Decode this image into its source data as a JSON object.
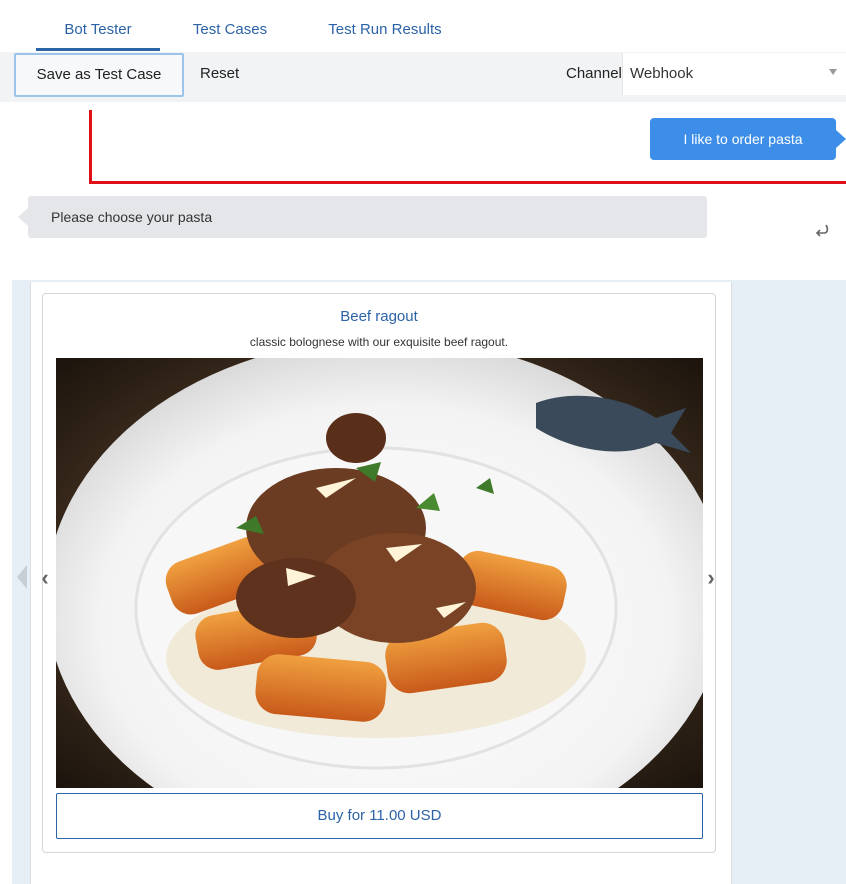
{
  "tabs": {
    "items": [
      {
        "label": "Bot Tester",
        "active": true
      },
      {
        "label": "Test Cases",
        "active": false
      },
      {
        "label": "Test Run Results",
        "active": false
      }
    ]
  },
  "toolbar": {
    "save_label": "Save as Test Case",
    "reset_label": "Reset",
    "channel_label": "Channel",
    "channel_value": "Webhook"
  },
  "conversation": {
    "user_message": "I like to order pasta",
    "bot_message": "Please choose your pasta"
  },
  "card": {
    "title": "Beef ragout",
    "subtitle": "classic bolognese with our exquisite beef ragout.",
    "image_icon": "pasta-photo",
    "buy_label": "Buy for 11.00 USD"
  },
  "colors": {
    "accent": "#2b63a6",
    "user_bubble": "#3d8ee8",
    "annotation": "#e0101a",
    "carousel_bg": "#e6eef6"
  }
}
